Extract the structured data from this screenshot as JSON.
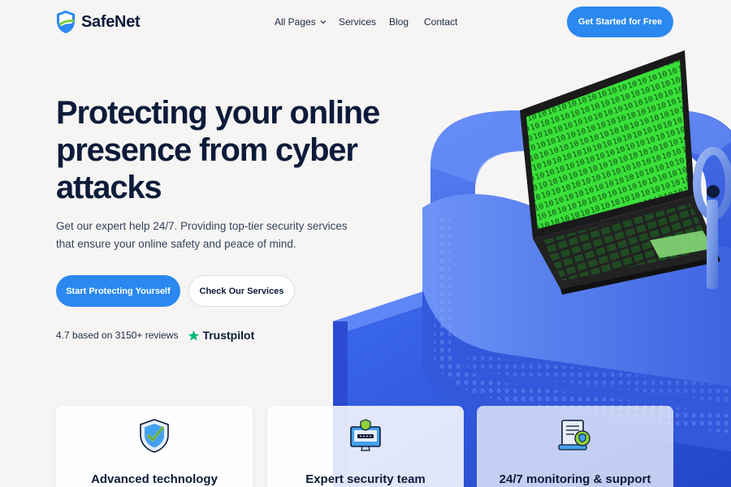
{
  "brand": {
    "name": "SafeNet",
    "logo_icon": "shield-icon"
  },
  "nav": {
    "items": [
      {
        "label": "All Pages",
        "has_dropdown": true
      },
      {
        "label": "Services"
      },
      {
        "label": "Blog"
      },
      {
        "label": "Contact"
      }
    ],
    "cta_label": "Get Started for Free"
  },
  "hero": {
    "title": "Protecting your online presence from cyber attacks",
    "subtitle": "Get our expert help 24/7. Providing top-tier security services that ensure your online safety and peace of mind.",
    "primary_button": "Start Protecting Yourself",
    "secondary_button": "Check Our Services",
    "rating_text": "4.7 based on 3150+ reviews",
    "trustpilot_label": "Trustpilot"
  },
  "features": [
    {
      "title": "Advanced technology",
      "icon": "shield-check-icon"
    },
    {
      "title": "Expert security team",
      "icon": "monitor-shield-icon"
    },
    {
      "title": "24/7 monitoring & support",
      "icon": "document-shield-icon"
    }
  ],
  "colors": {
    "accent": "#2b88f0",
    "background": "#f6f5f3",
    "text_dark": "#0d1b3a",
    "trustpilot_green": "#00b67a",
    "screen_green": "#3ae03a",
    "lock_blue": "#3e68e6"
  }
}
